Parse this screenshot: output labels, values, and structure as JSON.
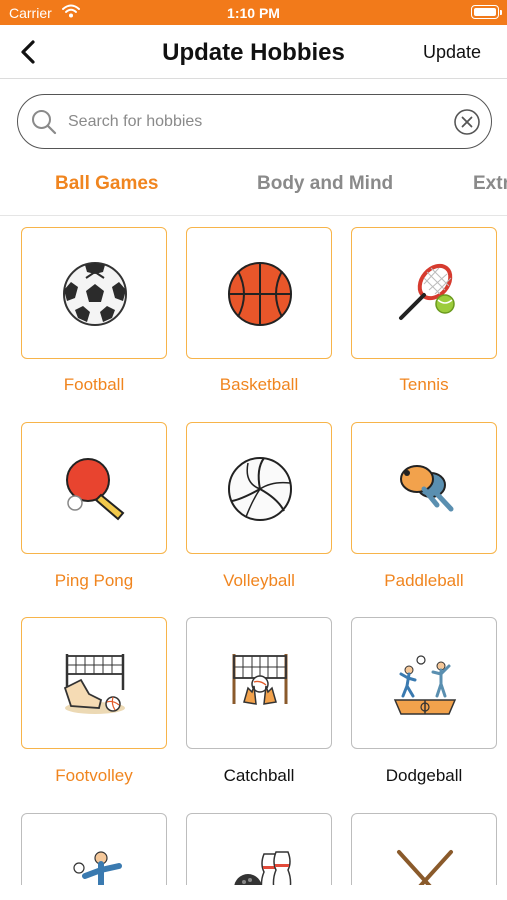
{
  "status_bar": {
    "carrier": "Carrier",
    "time": "1:10 PM"
  },
  "nav": {
    "title": "Update Hobbies",
    "update_label": "Update"
  },
  "search": {
    "placeholder": "Search for hobbies",
    "value": ""
  },
  "tabs": [
    {
      "label": "Ball Games",
      "active": true
    },
    {
      "label": "Body and Mind",
      "active": false
    },
    {
      "label": "Extr",
      "active": false
    }
  ],
  "hobbies": [
    {
      "label": "Football",
      "icon": "soccer-ball-icon",
      "selected": true
    },
    {
      "label": "Basketball",
      "icon": "basketball-icon",
      "selected": true
    },
    {
      "label": "Tennis",
      "icon": "tennis-racket-icon",
      "selected": true
    },
    {
      "label": "Ping Pong",
      "icon": "ping-pong-paddle-icon",
      "selected": true
    },
    {
      "label": "Volleyball",
      "icon": "volleyball-icon",
      "selected": true
    },
    {
      "label": "Paddleball",
      "icon": "paddleball-icon",
      "selected": true
    },
    {
      "label": "Footvolley",
      "icon": "footvolley-icon",
      "selected": true
    },
    {
      "label": "Catchball",
      "icon": "catchball-icon",
      "selected": false
    },
    {
      "label": "Dodgeball",
      "icon": "dodgeball-icon",
      "selected": false
    },
    {
      "label": "",
      "icon": "player-throwing-icon",
      "selected": false
    },
    {
      "label": "",
      "icon": "bowling-icon",
      "selected": false
    },
    {
      "label": "",
      "icon": "crossed-sticks-icon",
      "selected": false
    }
  ],
  "colors": {
    "accent": "#f0851f",
    "status_bar": "#f27a1a",
    "tile_selected_border": "#f7b44a",
    "tile_border": "#bdbdbd"
  }
}
